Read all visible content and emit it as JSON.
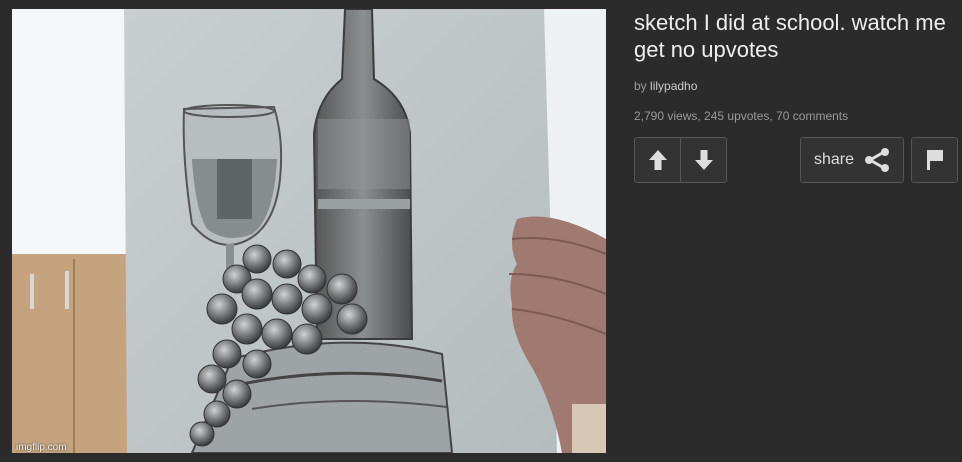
{
  "post": {
    "title": "sketch I did at school. watch me get no upvotes",
    "by_prefix": "by",
    "author": "lilypadho",
    "stats": "2,790 views, 245 upvotes, 70 comments"
  },
  "image": {
    "watermark": "imgflip.com"
  },
  "actions": {
    "share_label": "share"
  },
  "icons": {
    "upvote": "arrow-up-icon",
    "downvote": "arrow-down-icon",
    "share": "share-icon",
    "flag": "flag-icon"
  },
  "colors": {
    "background": "#2b2b2b",
    "button_border": "#555555",
    "title_text": "#eeeeee",
    "meta_text": "#999999"
  }
}
